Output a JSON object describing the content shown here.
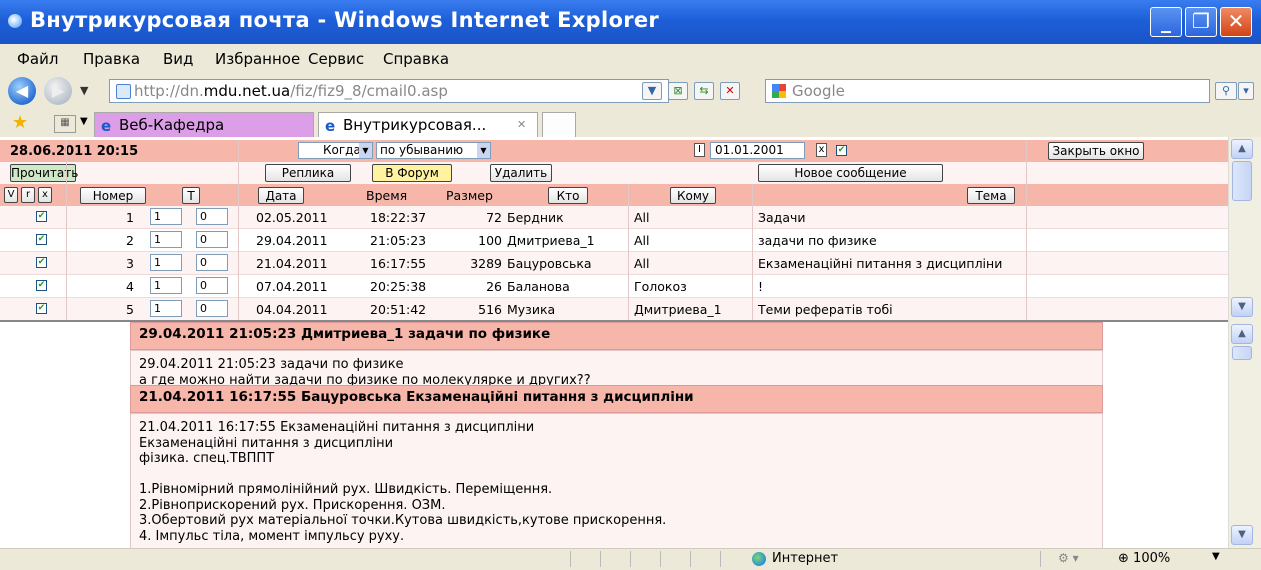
{
  "window": {
    "title": "Внутрикурсовая почта - Windows Internet Explorer",
    "min_glyph": "_",
    "max_glyph": "❐",
    "close_glyph": "✕"
  },
  "menu": [
    "Файл",
    "Правка",
    "Вид",
    "Избранное",
    "Сервис",
    "Справка"
  ],
  "address": {
    "url_prefix": "http://dn.",
    "url_domain": "mdu.net.ua",
    "url_path": "/fiz/fiz9_8/cmail0.asp",
    "search_placeholder": "Google"
  },
  "tabs": [
    {
      "label": "Веб-Кафедра"
    },
    {
      "label": "Внутрикурсовая...",
      "close": "✕"
    }
  ],
  "mail": {
    "datetime": "28.06.2011 20:15",
    "sort_field": "Когда",
    "sort_order": "по убыванию",
    "date_filter": "01.01.2001",
    "date_filter_box": "I",
    "clear_glyph": "x",
    "close_window_label": "Закрыть окно",
    "read_label": "Прочитать",
    "reply_label": "Реплика",
    "forum_label": "В Форум",
    "delete_label": "Удалить",
    "new_message_label": "Новое сообщение",
    "header": {
      "chk_v": "V",
      "chk_r": "r",
      "chk_x": "x",
      "number": "Номер",
      "t": "T",
      "date": "Дата",
      "time": "Время",
      "size": "Размер",
      "from": "Кто",
      "to": "Кому",
      "subject": "Тема"
    },
    "rows": [
      {
        "num": "1",
        "a": "1",
        "b": "0",
        "date": "02.05.2011",
        "time": "18:22:37",
        "size": "72",
        "from": "Бердник",
        "to": "All",
        "subject": "Задачи"
      },
      {
        "num": "2",
        "a": "1",
        "b": "0",
        "date": "29.04.2011",
        "time": "21:05:23",
        "size": "100",
        "from": "Дмитриева_1",
        "to": "All",
        "subject": "задачи по физике"
      },
      {
        "num": "3",
        "a": "1",
        "b": "0",
        "date": "21.04.2011",
        "time": "16:17:55",
        "size": "3289",
        "from": "Бацуровська",
        "to": "All",
        "subject": "Екзаменаційні питання з дисципліни"
      },
      {
        "num": "4",
        "a": "1",
        "b": "0",
        "date": "07.04.2011",
        "time": "20:25:38",
        "size": "26",
        "from": "Баланова",
        "to": "Голокоз",
        "subject": "!"
      },
      {
        "num": "5",
        "a": "1",
        "b": "0",
        "date": "04.04.2011",
        "time": "20:51:42",
        "size": "516",
        "from": "Музика",
        "to": "Дмитриева_1",
        "subject": "Теми рефератів тобі"
      }
    ],
    "check_glyph": "✔"
  },
  "messages": [
    {
      "head": "29.04.2011 21:05:23 Дмитриева_1 задачи по физике",
      "body": "29.04.2011 21:05:23 задачи по физике\nа где можно найти задачи по физике по молекулярке и других??"
    },
    {
      "head": "21.04.2011 16:17:55 Бацуровська Екзаменаційні питання з дисципліни",
      "body": "21.04.2011 16:17:55 Екзаменаційні питання з дисципліни\nЕкзаменаційні питання з дисципліни\nфізика. спец.ТВППТ\n\n1.Рівномірний прямолінійний рух. Швидкість. Переміщення.\n2.Рівноприскорений рух. Прискорення. ОЗМ.\n3.Обертовий рух матеріальної точки.Кутова швидкість,кутове прискорення.\n4. Імпульс тіла, момент імпульсу руху."
    }
  ],
  "status": {
    "zone": "Интернет",
    "zoom": "100%"
  },
  "colors": {
    "header_bg": "#f7b6aa",
    "row_bg": "#fdf3f3",
    "forum_btn": "#fff3a0"
  }
}
